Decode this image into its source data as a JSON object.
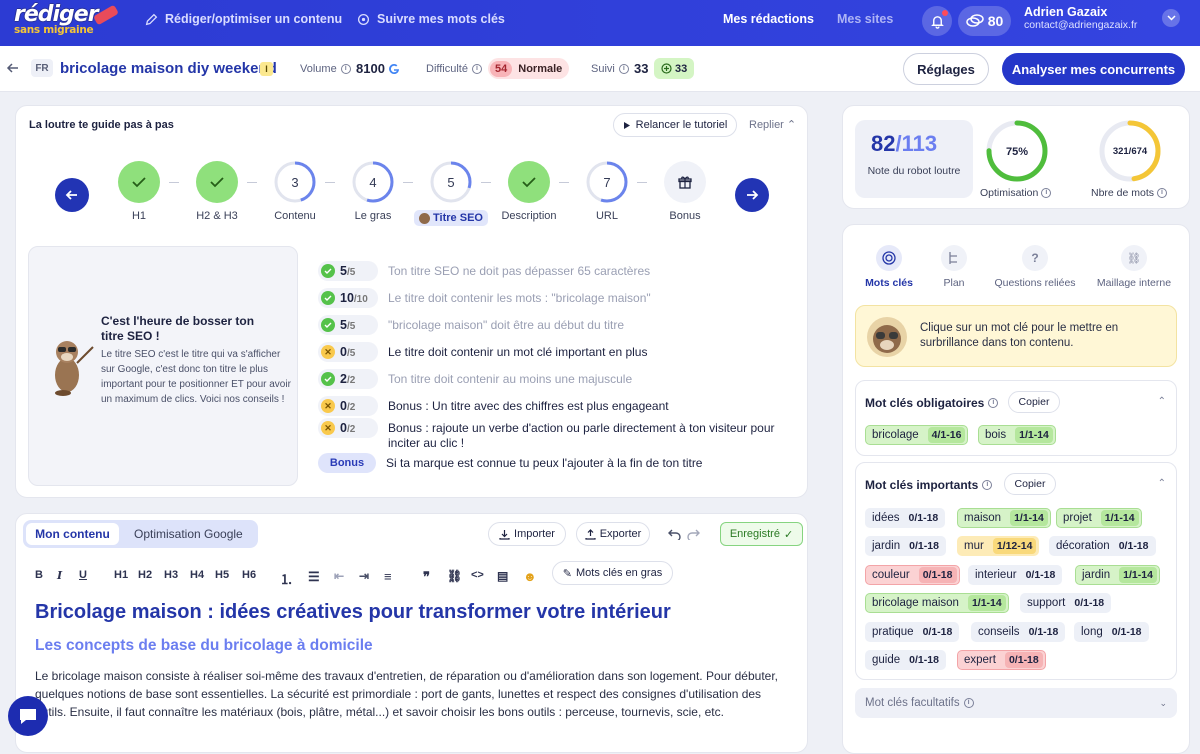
{
  "brand": {
    "line1": "rédiger",
    "line2": "sans migraine"
  },
  "nav": {
    "write": "Rédiger/optimiser un contenu",
    "follow": "Suivre mes mots clés",
    "mine": "Mes rédactions",
    "sites": "Mes sites",
    "credits": "80"
  },
  "user": {
    "name": "Adrien Gazaix",
    "email": "contact@adriengazaix.fr"
  },
  "keyword_bar": {
    "lang": "FR",
    "keyword": "bricolage maison diy weekend",
    "tag": "I",
    "volume_label": "Volume",
    "volume": "8100",
    "difficulty_label": "Difficulté",
    "difficulty": "54",
    "difficulty_text": "Normale",
    "suivi_label": "Suivi",
    "suivi": "33",
    "suivi_badge": "33",
    "settings": "Réglages",
    "analyze": "Analyser mes concurrents"
  },
  "guide": {
    "title": "La loutre te guide pas à pas",
    "relaunch": "Relancer le tutoriel",
    "collapse": "Replier",
    "steps": [
      {
        "label": "H1",
        "state": "done",
        "text": ""
      },
      {
        "label": "H2 & H3",
        "state": "done",
        "text": ""
      },
      {
        "label": "Contenu",
        "state": "progress",
        "text": "3"
      },
      {
        "label": "Le gras",
        "state": "progress",
        "text": "4"
      },
      {
        "label": "Titre SEO",
        "state": "current",
        "text": "5"
      },
      {
        "label": "Description",
        "state": "done",
        "text": ""
      },
      {
        "label": "URL",
        "state": "progress",
        "text": "7"
      },
      {
        "label": "Bonus",
        "state": "gift",
        "text": ""
      }
    ],
    "tip_title": "C'est l'heure de bosser ton titre SEO !",
    "tip_body": "Le titre SEO c'est le titre qui va s'afficher sur Google, c'est donc ton titre le plus important pour te positionner ET pour avoir un maximum de clics. Voici nos conseils !",
    "criteria": [
      {
        "status": "ok",
        "score": "5",
        "max": "/5",
        "text": "Ton titre SEO ne doit pas dépasser 65 caractères"
      },
      {
        "status": "ok",
        "score": "10",
        "max": "/10",
        "text": "Le titre doit contenir les mots : \"bricolage maison\""
      },
      {
        "status": "ok",
        "score": "5",
        "max": "/5",
        "text": "\"bricolage maison\" doit être au début du titre"
      },
      {
        "status": "ko",
        "score": "0",
        "max": "/5",
        "text": "Le titre doit contenir un mot clé important en plus"
      },
      {
        "status": "ok",
        "score": "2",
        "max": "/2",
        "text": "Ton titre doit contenir au moins une majuscule"
      },
      {
        "status": "ko",
        "score": "0",
        "max": "/2",
        "text": "Bonus : Un titre avec des chiffres est plus engageant"
      },
      {
        "status": "ko",
        "score": "0",
        "max": "/2",
        "text": "Bonus : rajoute un verbe d'action ou parle directement à ton visiteur pour inciter au clic !"
      },
      {
        "status": "bonus",
        "score": "Bonus",
        "max": "",
        "text": "Si ta marque est connue tu peux l'ajouter à la fin de ton titre"
      }
    ]
  },
  "editor": {
    "tab_content": "Mon contenu",
    "tab_google": "Optimisation Google",
    "import": "Importer",
    "export": "Exporter",
    "saved": "Enregistré",
    "toolbar": [
      "B",
      "I",
      "U",
      "H1",
      "H2",
      "H3",
      "H4",
      "H5",
      "H6"
    ],
    "kw_bold": "Mots clés en gras",
    "h1": "Bricolage maison : idées créatives pour transformer votre intérieur",
    "h2": "Les concepts de base du bricolage à domicile",
    "paragraph": "Le bricolage maison consiste à réaliser soi-même des travaux d'entretien, de réparation ou d'amélioration dans son logement. Pour débuter, quelques notions de base sont essentielles. La sécurité est primordiale : port de gants, lunettes et respect des consignes d'utilisation des outils. Ensuite, il faut connaître les matériaux (bois, plâtre, métal...) et savoir choisir les bons outils : perceuse, tournevis, scie, etc."
  },
  "score": {
    "value": "82",
    "max": "/113",
    "label": "Note du robot loutre",
    "optimisation": "75%",
    "optimisation_label": "Optimisation",
    "optimisation_fraction": 0.75,
    "words": "321/674",
    "words_label": "Nbre de mots",
    "words_fraction": 0.476
  },
  "right_tabs": [
    "Mots clés",
    "Plan",
    "Questions reliées",
    "Maillage interne"
  ],
  "helper": "Clique sur un mot clé pour le mettre en surbrillance dans ton contenu.",
  "mandatory": {
    "title": "Mot clés obligatoires",
    "copy": "Copier",
    "chips": [
      {
        "w": "bricolage",
        "c": "4/1-16",
        "s": "g"
      },
      {
        "w": "bois",
        "c": "1/1-14",
        "s": "g"
      }
    ]
  },
  "important": {
    "title": "Mot clés importants",
    "copy": "Copier",
    "chips": [
      {
        "w": "idées",
        "c": "0/1-18",
        "s": "n"
      },
      {
        "w": "maison",
        "c": "1/1-14",
        "s": "g"
      },
      {
        "w": "projet",
        "c": "1/1-14",
        "s": "g"
      },
      {
        "w": "jardin",
        "c": "0/1-18",
        "s": "n"
      },
      {
        "w": "mur",
        "c": "1/12-14",
        "s": "y"
      },
      {
        "w": "décoration",
        "c": "0/1-18",
        "s": "n"
      },
      {
        "w": "couleur",
        "c": "0/1-18",
        "s": "r"
      },
      {
        "w": "interieur",
        "c": "0/1-18",
        "s": "n"
      },
      {
        "w": "jardin",
        "c": "1/1-14",
        "s": "g"
      },
      {
        "w": "bricolage maison",
        "c": "1/1-14",
        "s": "g"
      },
      {
        "w": "support",
        "c": "0/1-18",
        "s": "n"
      },
      {
        "w": "pratique",
        "c": "0/1-18",
        "s": "n"
      },
      {
        "w": "conseils",
        "c": "0/1-18",
        "s": "n"
      },
      {
        "w": "long",
        "c": "0/1-18",
        "s": "n"
      },
      {
        "w": "guide",
        "c": "0/1-18",
        "s": "n"
      },
      {
        "w": "expert",
        "c": "0/1-18",
        "s": "r"
      }
    ]
  },
  "optional": {
    "title": "Mot clés facultatifs"
  }
}
